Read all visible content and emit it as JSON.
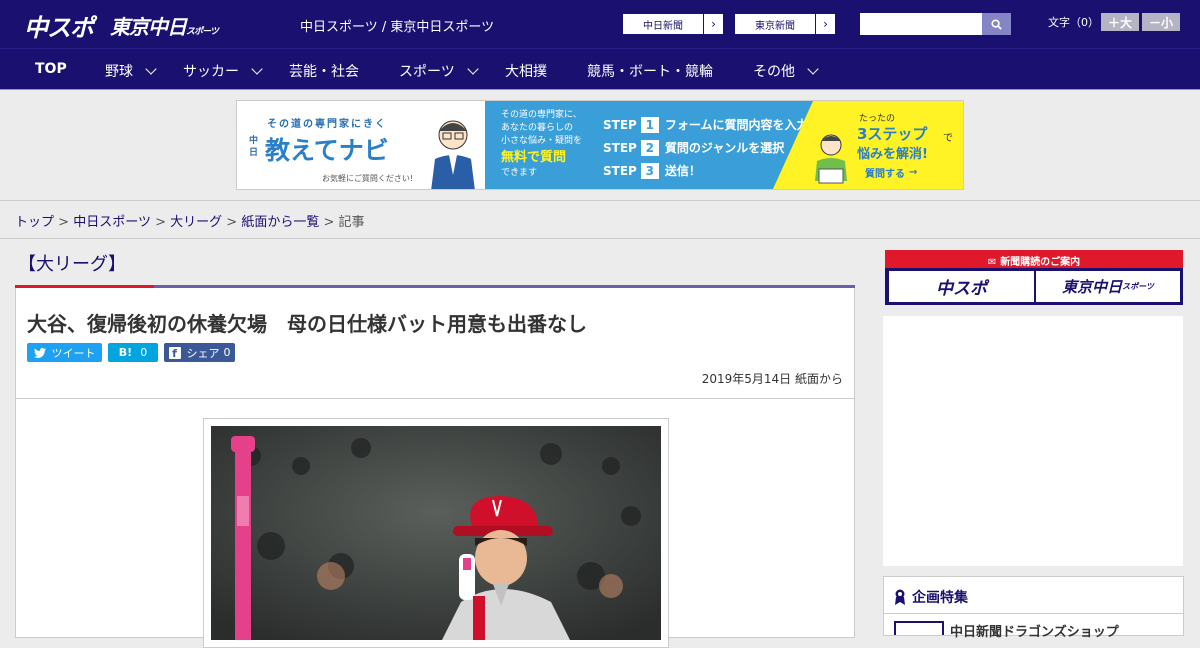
{
  "header": {
    "logo_main": "中スポ",
    "logo_sub": "東京中日",
    "logo_sub_small": "スポーツ",
    "site_label": "中日スポーツ / 東京中日スポーツ",
    "paper_buttons": [
      {
        "label": "中日新聞"
      },
      {
        "label": "東京新聞"
      }
    ],
    "search": {
      "placeholder": ""
    },
    "font_size_label": "文字（0）",
    "font_larger": "＋大",
    "font_smaller": "－小"
  },
  "nav": {
    "items": [
      {
        "label": "TOP",
        "has_menu": false
      },
      {
        "label": "野球",
        "has_menu": true
      },
      {
        "label": "サッカー",
        "has_menu": true
      },
      {
        "label": "芸能・社会",
        "has_menu": false
      },
      {
        "label": "スポーツ",
        "has_menu": true
      },
      {
        "label": "大相撲",
        "has_menu": false
      },
      {
        "label": "競馬・ボート・競輪",
        "has_menu": false
      },
      {
        "label": "その他",
        "has_menu": true
      }
    ]
  },
  "ad_banner": {
    "tagline": "その道の専門家にきく",
    "brand_small": "中日",
    "brand": "教えてナビ",
    "note": "お気軽にご質問ください!",
    "desc_lines": [
      "その道の専門家に、",
      "あなたの暮らしの",
      "小さな悩み・疑問を"
    ],
    "free": "無料で質問",
    "desc_end": "できます",
    "steps": [
      {
        "label": "STEP",
        "num": "1",
        "text": "フォームに質問内容を入力"
      },
      {
        "label": "STEP",
        "num": "2",
        "text": "質問のジャンルを選択"
      },
      {
        "label": "STEP",
        "num": "3",
        "text": "送信！"
      }
    ],
    "cta_small": "たったの",
    "cta_big": "3ステップ",
    "cta_de": "で",
    "cta_solve": "悩みを解消!",
    "cta_button": "質問する"
  },
  "breadcrumb": {
    "items": [
      "トップ",
      "中日スポーツ",
      "大リーグ",
      "紙面から一覧"
    ],
    "separator": ">",
    "current": "記事"
  },
  "article": {
    "category": "【大リーグ】",
    "headline": "大谷、復帰後初の休養欠場　母の日仕様バット用意も出番なし",
    "share": {
      "tweet": "ツイート",
      "hatena": "B!",
      "hatena_count": "0",
      "facebook": "シェア",
      "facebook_count": "0"
    },
    "date": "2019年5月14日 紙面から"
  },
  "sidebar": {
    "subscription_header": "新聞購読のご案内",
    "sub_logos": [
      "中スポ",
      "東京中日"
    ],
    "sub_logo_small": "スポーツ",
    "feature_title": "企画特集",
    "feature_item": "中日新聞ドラゴンズショップ"
  },
  "colors": {
    "brand": "#1a1070",
    "accent_red": "#e0182b",
    "twitter": "#1da1f2",
    "hatena": "#00a4de",
    "facebook": "#3b5998",
    "banner_blue": "#3a9fd8",
    "banner_yellow": "#fff225"
  }
}
